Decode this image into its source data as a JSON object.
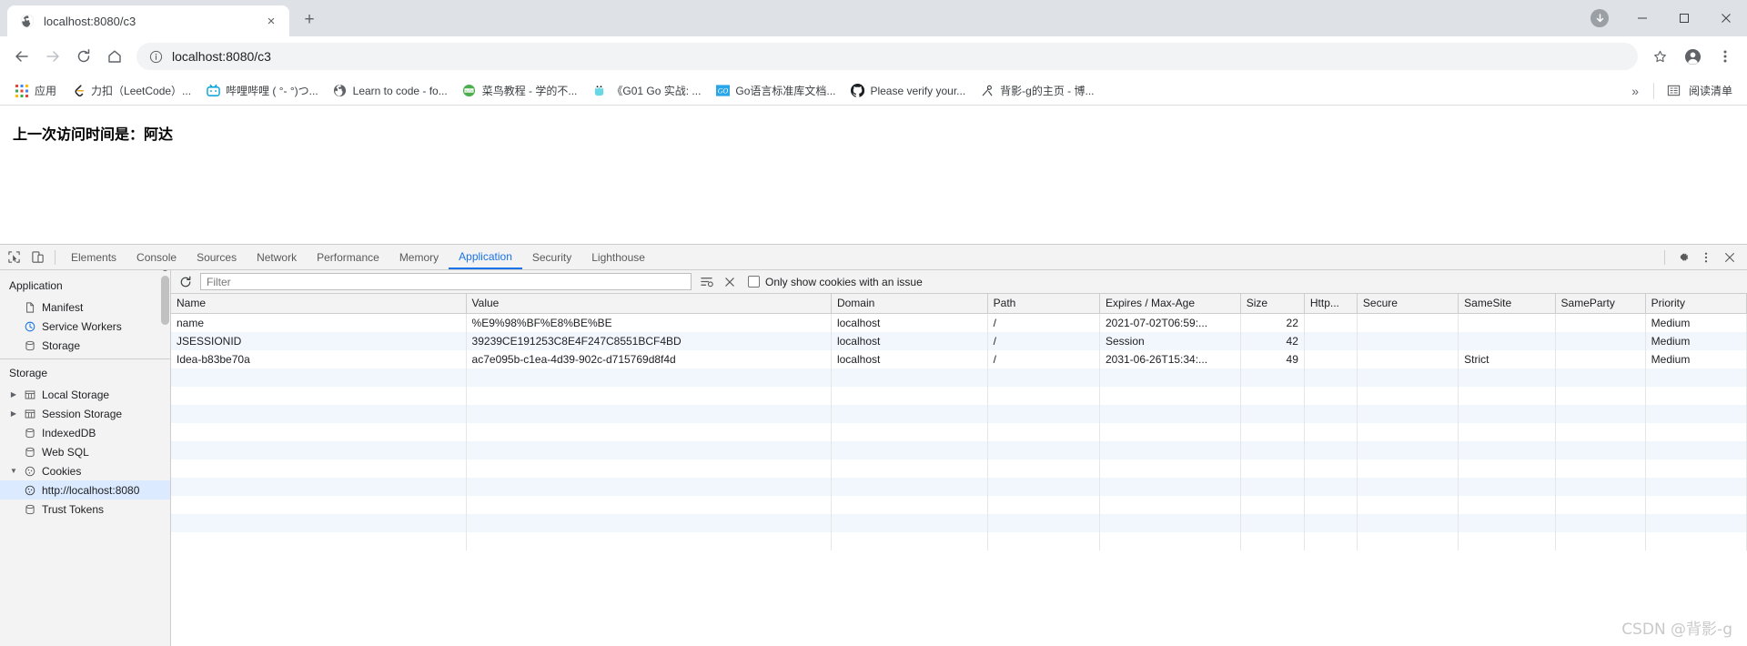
{
  "browser": {
    "tab": {
      "title": "localhost:8080/c3",
      "favicon": "globe-icon",
      "close": "×"
    },
    "new_tab": "+",
    "window_controls": {
      "minimize": "—",
      "maximize": "☐",
      "close": "✕",
      "update_badge": "↓"
    },
    "nav": {
      "back": "←",
      "forward": "→",
      "reload": "↻",
      "home": "⌂"
    },
    "omnibox": {
      "url": "localhost:8080/c3",
      "info_icon": "info-circle-icon",
      "star_icon": "star-icon",
      "profile_icon": "avatar-icon",
      "menu_icon": "kebab-menu-icon"
    },
    "bookmarks": [
      {
        "label": "应用",
        "icon": "apps-grid-icon"
      },
      {
        "label": "力扣（LeetCode）...",
        "icon": "leetcode-icon"
      },
      {
        "label": "哔哩哔哩 ( °- °)つ...",
        "icon": "bilibili-icon"
      },
      {
        "label": "Learn to code - fo...",
        "icon": "globe-icon"
      },
      {
        "label": "菜鸟教程 - 学的不...",
        "icon": "runoob-icon"
      },
      {
        "label": "《G01 Go 实战: ...",
        "icon": "gopher-icon"
      },
      {
        "label": "Go语言标准库文档...",
        "icon": "go-icon"
      },
      {
        "label": "Please verify your...",
        "icon": "github-icon"
      },
      {
        "label": "背影-g的主页 - 博...",
        "icon": "csdn-icon"
      }
    ],
    "bookmarks_overflow": "»",
    "reading_list": {
      "label": "阅读清单",
      "icon": "reading-list-icon"
    }
  },
  "page": {
    "text": "上一次访问时间是：阿达"
  },
  "devtools": {
    "inspect_icon": "inspect-cursor-icon",
    "device_icon": "device-toolbar-icon",
    "tabs": [
      {
        "label": "Elements",
        "active": false
      },
      {
        "label": "Console",
        "active": false
      },
      {
        "label": "Sources",
        "active": false
      },
      {
        "label": "Network",
        "active": false
      },
      {
        "label": "Performance",
        "active": false
      },
      {
        "label": "Memory",
        "active": false
      },
      {
        "label": "Application",
        "active": true
      },
      {
        "label": "Security",
        "active": false
      },
      {
        "label": "Lighthouse",
        "active": false
      }
    ],
    "settings_icon": "gear-icon",
    "more_icon": "kebab-menu-icon",
    "close_icon": "close-icon",
    "sidebar": {
      "group1_title": "Application",
      "group1_items": [
        {
          "label": "Manifest",
          "icon": "manifest-icon",
          "expandable": false
        },
        {
          "label": "Service Workers",
          "icon": "service-worker-icon",
          "expandable": false
        },
        {
          "label": "Storage",
          "icon": "storage-icon",
          "expandable": false
        }
      ],
      "group2_title": "Storage",
      "group2_items": [
        {
          "label": "Local Storage",
          "icon": "table-icon",
          "expandable": true,
          "expanded": false,
          "depth": 0
        },
        {
          "label": "Session Storage",
          "icon": "table-icon",
          "expandable": true,
          "expanded": false,
          "depth": 0
        },
        {
          "label": "IndexedDB",
          "icon": "database-icon",
          "expandable": false,
          "depth": 0
        },
        {
          "label": "Web SQL",
          "icon": "database-icon",
          "expandable": false,
          "depth": 0
        },
        {
          "label": "Cookies",
          "icon": "cookie-icon",
          "expandable": true,
          "expanded": true,
          "depth": 0
        },
        {
          "label": "http://localhost:8080",
          "icon": "cookie-icon",
          "expandable": false,
          "depth": 1,
          "selected": true
        },
        {
          "label": "Trust Tokens",
          "icon": "trust-token-icon",
          "expandable": false,
          "depth": 0
        }
      ]
    },
    "cookie_toolbar": {
      "refresh_icon": "refresh-icon",
      "filter_placeholder": "Filter",
      "filter_value": "",
      "clear_filter_icon": "filter-list-icon",
      "clear_all_icon": "clear-cookies-icon",
      "issue_checkbox_label": "Only show cookies with an issue",
      "issue_checkbox_checked": false
    },
    "cookie_table": {
      "columns": [
        "Name",
        "Value",
        "Domain",
        "Path",
        "Expires / Max-Age",
        "Size",
        "Http...",
        "Secure",
        "SameSite",
        "SameParty",
        "Priority"
      ],
      "rows": [
        {
          "Name": "name",
          "Value": "%E9%98%BF%E8%BE%BE",
          "Domain": "localhost",
          "Path": "/",
          "Expires / Max-Age": "2021-07-02T06:59:...",
          "Size": "22",
          "Http...": "",
          "Secure": "",
          "SameSite": "",
          "SameParty": "",
          "Priority": "Medium"
        },
        {
          "Name": "JSESSIONID",
          "Value": "39239CE191253C8E4F247C8551BCF4BD",
          "Domain": "localhost",
          "Path": "/",
          "Expires / Max-Age": "Session",
          "Size": "42",
          "Http...": "✓",
          "Secure": "",
          "SameSite": "",
          "SameParty": "",
          "Priority": "Medium"
        },
        {
          "Name": "Idea-b83be70a",
          "Value": "ac7e095b-c1ea-4d39-902c-d715769d8f4d",
          "Domain": "localhost",
          "Path": "/",
          "Expires / Max-Age": "2031-06-26T15:34:...",
          "Size": "49",
          "Http...": "✓",
          "Secure": "",
          "SameSite": "Strict",
          "SameParty": "",
          "Priority": "Medium"
        }
      ],
      "empty_rows": 10
    }
  },
  "watermark": "CSDN @背影-g",
  "colors": {
    "accent": "#1a73e8",
    "tabstrip": "#dee1e6",
    "devtools_bg": "#f3f3f3",
    "row_alt": "#f2f7fd",
    "selection": "#dbeafe"
  }
}
